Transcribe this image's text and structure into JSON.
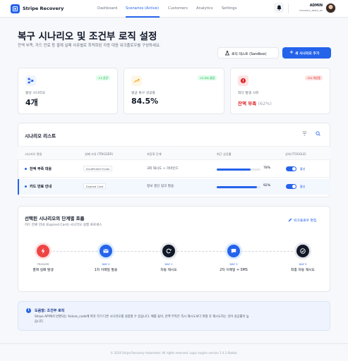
{
  "nav": {
    "brand": "Stripe Recovery",
    "links": [
      "Dashboard",
      "Scenarios (Active)",
      "Customers",
      "Analytics",
      "Settings"
    ],
    "admin_name": "ADMIN",
    "admin_email": "recovery_team_ex"
  },
  "header": {
    "title": "복구 시나리오 및 조건부 로직 설정",
    "description": "잔액 부족, 카드 만료 등 결제 실패 사유별로 최적화된 자동 대응 워크플로우를 구성하세요.",
    "sandbox_button": "로직 테스트 (Sandbox)",
    "add_button": "새 시나리오 추가"
  },
  "stats": [
    {
      "badge": "+1 신규",
      "label": "활성 시나리오",
      "value": "4개",
      "badge_color": "#16a34a"
    },
    {
      "badge": "+2.3% 성장",
      "label": "평균 복구 성공률",
      "value": "84.5%",
      "badge_color": "#16a34a"
    },
    {
      "badge": "-5% 개선중",
      "label": "최다 발생 사유",
      "value": "잔액 부족",
      "sub": "(62%)",
      "badge_color": "#dc2626"
    }
  ],
  "scenario_list": {
    "title": "시나리오 리스트",
    "columns": [
      "시나리오 명칭",
      "실패 사유 (TRIGGER)",
      "자동화 단계",
      "최근 성공률",
      "상태 (TOGGLE)"
    ],
    "rows": [
      {
        "name": "잔액 부족 대응",
        "trigger": "Insufficient Funds",
        "steps": "3회 재시도 + 리마인드",
        "rate_label": "78%",
        "rate": 0.78,
        "status": "활성"
      },
      {
        "name": "카드 만료 안내",
        "trigger": "Expired Card",
        "steps": "정보 갱신 링크 발송",
        "rate_label": "92%",
        "rate": 0.92,
        "status": "활성"
      }
    ]
  },
  "flow": {
    "title": "선택된 시나리오의 단계별 흐름",
    "subtitle": "카드 만료 안내 (Expired Card) 시나리오 실행 프로세스",
    "edit_link": "워크플로우 편집",
    "steps": [
      {
        "day": "TRIGGER",
        "name": "결제 실패 발생",
        "icon": "bolt-icon"
      },
      {
        "day": "DAY 0",
        "name": "1차 이메일 발송",
        "icon": "mail-icon"
      },
      {
        "day": "DAY 1",
        "name": "자동 재시도",
        "icon": "refresh-icon"
      },
      {
        "day": "DAY 3",
        "name": "2차 이메일 + SMS",
        "icon": "chat-icon"
      },
      {
        "day": "DAY 5",
        "name": "최종 자동 재시도",
        "icon": "check-icon"
      }
    ]
  },
  "info": {
    "title": "도움말: 조건부 로직",
    "text1": "Stripe API에서 반환되는 failure_code에 따라 각기 다른 시나리오를 설정할 수 있습니다. 예를 들어, 잔액 부족은 즉시 재시도보다 며칠 후 재시도하는 것이 성공률이 높습니다.",
    "text_line1": "Stripe API에서 반환되는 failure_code에 따라 각기 다른 시나리오를 설정할 수 있습니다. 예를 들어, 잔액 부족은 즉시 재시도보다 며칠 후 재시도하는 것이 성공률이 높",
    "text_line2": "습니다."
  },
  "footer": "© 2024 Stripe Recovery Automator. All rights reserved. Logic engine version 2.4.1-Stable.",
  "colors": {
    "accent": "#2563eb",
    "success": "#16a34a",
    "danger": "#dc2626"
  }
}
